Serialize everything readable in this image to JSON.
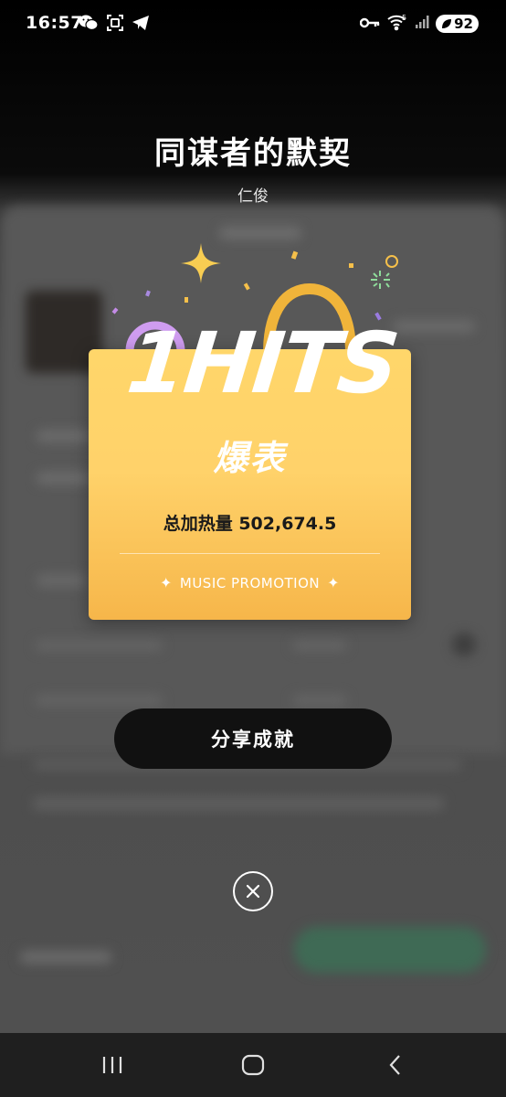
{
  "status_bar": {
    "time": "16:57",
    "left_icons": [
      "wechat-icon",
      "scan-icon",
      "telegram-icon"
    ],
    "right_icons": [
      "key-icon",
      "wifi-icon",
      "signal-icon"
    ],
    "battery_level": "92"
  },
  "popup": {
    "title": "同谋者的默契",
    "subtitle": "仁俊",
    "card": {
      "logo_text": "1HITS",
      "badge_name": "爆表",
      "heat_label": "总加热量",
      "heat_value": "502,674.5",
      "promo_label": "MUSIC PROMOTION",
      "colors": {
        "card_top": "#ffd66a",
        "card_bottom": "#f6b64a",
        "handle": "#f0b43a"
      }
    },
    "share_button": "分享成就",
    "close_icon": "close-icon"
  },
  "nav_bar": {
    "buttons": [
      "recent-apps-icon",
      "home-icon",
      "back-icon"
    ]
  }
}
